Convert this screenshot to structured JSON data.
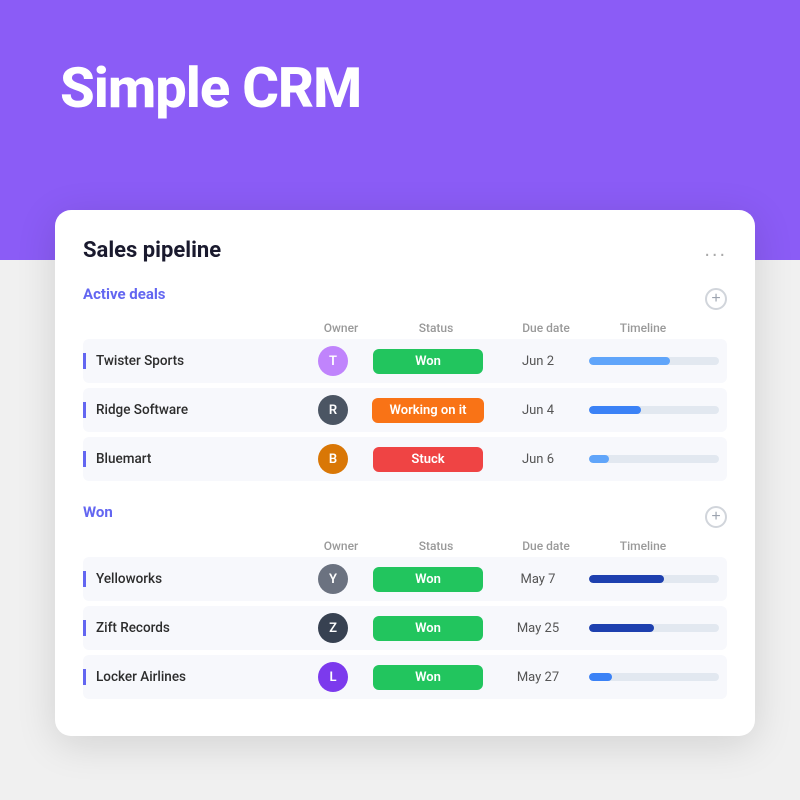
{
  "hero": {
    "title": "Simple CRM"
  },
  "card": {
    "title": "Sales pipeline",
    "more_label": "...",
    "sections": [
      {
        "id": "active",
        "title": "Active deals",
        "add_label": "+",
        "columns": {
          "owner": "Owner",
          "status": "Status",
          "due_date": "Due date",
          "timeline": "Timeline"
        },
        "deals": [
          {
            "name": "Twister Sports",
            "owner_initials": "T",
            "owner_color": "avatar-1",
            "status": "Won",
            "status_class": "status-won",
            "due": "Jun 2",
            "timeline_pct": 62,
            "timeline_color": "tl-blue-light"
          },
          {
            "name": "Ridge Software",
            "owner_initials": "R",
            "owner_color": "avatar-2",
            "status": "Working on it",
            "status_class": "status-working",
            "due": "Jun 4",
            "timeline_pct": 40,
            "timeline_color": "tl-blue-med"
          },
          {
            "name": "Bluemart",
            "owner_initials": "B",
            "owner_color": "avatar-3",
            "status": "Stuck",
            "status_class": "status-stuck",
            "due": "Jun 6",
            "timeline_pct": 15,
            "timeline_color": "tl-blue-light"
          }
        ]
      },
      {
        "id": "won",
        "title": "Won",
        "add_label": "+",
        "columns": {
          "owner": "Owner",
          "status": "Status",
          "due_date": "Due date",
          "timeline": "Timeline"
        },
        "deals": [
          {
            "name": "Yelloworks",
            "owner_initials": "Y",
            "owner_color": "avatar-4",
            "status": "Won",
            "status_class": "status-won",
            "due": "May 7",
            "timeline_pct": 58,
            "timeline_color": "tl-blue-dark"
          },
          {
            "name": "Zift Records",
            "owner_initials": "Z",
            "owner_color": "avatar-5",
            "status": "Won",
            "status_class": "status-won",
            "due": "May 25",
            "timeline_pct": 50,
            "timeline_color": "tl-blue-dark"
          },
          {
            "name": "Locker Airlines",
            "owner_initials": "L",
            "owner_color": "avatar-6",
            "status": "Won",
            "status_class": "status-won",
            "due": "May 27",
            "timeline_pct": 18,
            "timeline_color": "tl-blue-med"
          }
        ]
      }
    ]
  }
}
